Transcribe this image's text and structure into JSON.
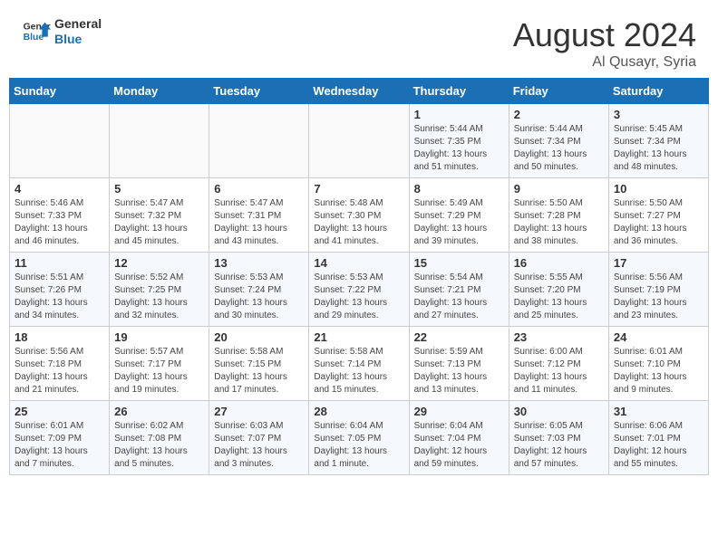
{
  "logo": {
    "line1": "General",
    "line2": "Blue"
  },
  "title": "August 2024",
  "subtitle": "Al Qusayr, Syria",
  "days_of_week": [
    "Sunday",
    "Monday",
    "Tuesday",
    "Wednesday",
    "Thursday",
    "Friday",
    "Saturday"
  ],
  "weeks": [
    [
      {
        "day": "",
        "info": ""
      },
      {
        "day": "",
        "info": ""
      },
      {
        "day": "",
        "info": ""
      },
      {
        "day": "",
        "info": ""
      },
      {
        "day": "1",
        "sunrise": "5:44 AM",
        "sunset": "7:35 PM",
        "daylight": "13 hours and 51 minutes."
      },
      {
        "day": "2",
        "sunrise": "5:44 AM",
        "sunset": "7:34 PM",
        "daylight": "13 hours and 50 minutes."
      },
      {
        "day": "3",
        "sunrise": "5:45 AM",
        "sunset": "7:34 PM",
        "daylight": "13 hours and 48 minutes."
      }
    ],
    [
      {
        "day": "4",
        "sunrise": "5:46 AM",
        "sunset": "7:33 PM",
        "daylight": "13 hours and 46 minutes."
      },
      {
        "day": "5",
        "sunrise": "5:47 AM",
        "sunset": "7:32 PM",
        "daylight": "13 hours and 45 minutes."
      },
      {
        "day": "6",
        "sunrise": "5:47 AM",
        "sunset": "7:31 PM",
        "daylight": "13 hours and 43 minutes."
      },
      {
        "day": "7",
        "sunrise": "5:48 AM",
        "sunset": "7:30 PM",
        "daylight": "13 hours and 41 minutes."
      },
      {
        "day": "8",
        "sunrise": "5:49 AM",
        "sunset": "7:29 PM",
        "daylight": "13 hours and 39 minutes."
      },
      {
        "day": "9",
        "sunrise": "5:50 AM",
        "sunset": "7:28 PM",
        "daylight": "13 hours and 38 minutes."
      },
      {
        "day": "10",
        "sunrise": "5:50 AM",
        "sunset": "7:27 PM",
        "daylight": "13 hours and 36 minutes."
      }
    ],
    [
      {
        "day": "11",
        "sunrise": "5:51 AM",
        "sunset": "7:26 PM",
        "daylight": "13 hours and 34 minutes."
      },
      {
        "day": "12",
        "sunrise": "5:52 AM",
        "sunset": "7:25 PM",
        "daylight": "13 hours and 32 minutes."
      },
      {
        "day": "13",
        "sunrise": "5:53 AM",
        "sunset": "7:24 PM",
        "daylight": "13 hours and 30 minutes."
      },
      {
        "day": "14",
        "sunrise": "5:53 AM",
        "sunset": "7:22 PM",
        "daylight": "13 hours and 29 minutes."
      },
      {
        "day": "15",
        "sunrise": "5:54 AM",
        "sunset": "7:21 PM",
        "daylight": "13 hours and 27 minutes."
      },
      {
        "day": "16",
        "sunrise": "5:55 AM",
        "sunset": "7:20 PM",
        "daylight": "13 hours and 25 minutes."
      },
      {
        "day": "17",
        "sunrise": "5:56 AM",
        "sunset": "7:19 PM",
        "daylight": "13 hours and 23 minutes."
      }
    ],
    [
      {
        "day": "18",
        "sunrise": "5:56 AM",
        "sunset": "7:18 PM",
        "daylight": "13 hours and 21 minutes."
      },
      {
        "day": "19",
        "sunrise": "5:57 AM",
        "sunset": "7:17 PM",
        "daylight": "13 hours and 19 minutes."
      },
      {
        "day": "20",
        "sunrise": "5:58 AM",
        "sunset": "7:15 PM",
        "daylight": "13 hours and 17 minutes."
      },
      {
        "day": "21",
        "sunrise": "5:58 AM",
        "sunset": "7:14 PM",
        "daylight": "13 hours and 15 minutes."
      },
      {
        "day": "22",
        "sunrise": "5:59 AM",
        "sunset": "7:13 PM",
        "daylight": "13 hours and 13 minutes."
      },
      {
        "day": "23",
        "sunrise": "6:00 AM",
        "sunset": "7:12 PM",
        "daylight": "13 hours and 11 minutes."
      },
      {
        "day": "24",
        "sunrise": "6:01 AM",
        "sunset": "7:10 PM",
        "daylight": "13 hours and 9 minutes."
      }
    ],
    [
      {
        "day": "25",
        "sunrise": "6:01 AM",
        "sunset": "7:09 PM",
        "daylight": "13 hours and 7 minutes."
      },
      {
        "day": "26",
        "sunrise": "6:02 AM",
        "sunset": "7:08 PM",
        "daylight": "13 hours and 5 minutes."
      },
      {
        "day": "27",
        "sunrise": "6:03 AM",
        "sunset": "7:07 PM",
        "daylight": "13 hours and 3 minutes."
      },
      {
        "day": "28",
        "sunrise": "6:04 AM",
        "sunset": "7:05 PM",
        "daylight": "13 hours and 1 minute."
      },
      {
        "day": "29",
        "sunrise": "6:04 AM",
        "sunset": "7:04 PM",
        "daylight": "12 hours and 59 minutes."
      },
      {
        "day": "30",
        "sunrise": "6:05 AM",
        "sunset": "7:03 PM",
        "daylight": "12 hours and 57 minutes."
      },
      {
        "day": "31",
        "sunrise": "6:06 AM",
        "sunset": "7:01 PM",
        "daylight": "12 hours and 55 minutes."
      }
    ]
  ]
}
